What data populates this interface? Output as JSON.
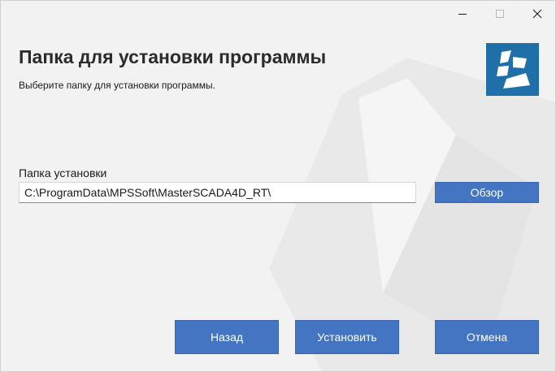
{
  "window": {
    "minimize_icon": "minimize-icon",
    "maximize_icon": "maximize-icon",
    "close_icon": "close-icon"
  },
  "header": {
    "title": "Папка для установки программы",
    "subtitle": "Выберите папку для установки программы.",
    "logo_icon": "app-logo-icon",
    "logo_color": "#1f6fa9"
  },
  "install_folder": {
    "label": "Папка установки",
    "value": "C:\\ProgramData\\MPSSoft\\MasterSCADA4D_RT\\",
    "browse_label": "Обзор"
  },
  "footer": {
    "back_label": "Назад",
    "install_label": "Установить",
    "cancel_label": "Отмена"
  },
  "colors": {
    "button_bg": "#4475c3",
    "button_text": "#ffffff",
    "window_bg": "#f2f2f2"
  }
}
